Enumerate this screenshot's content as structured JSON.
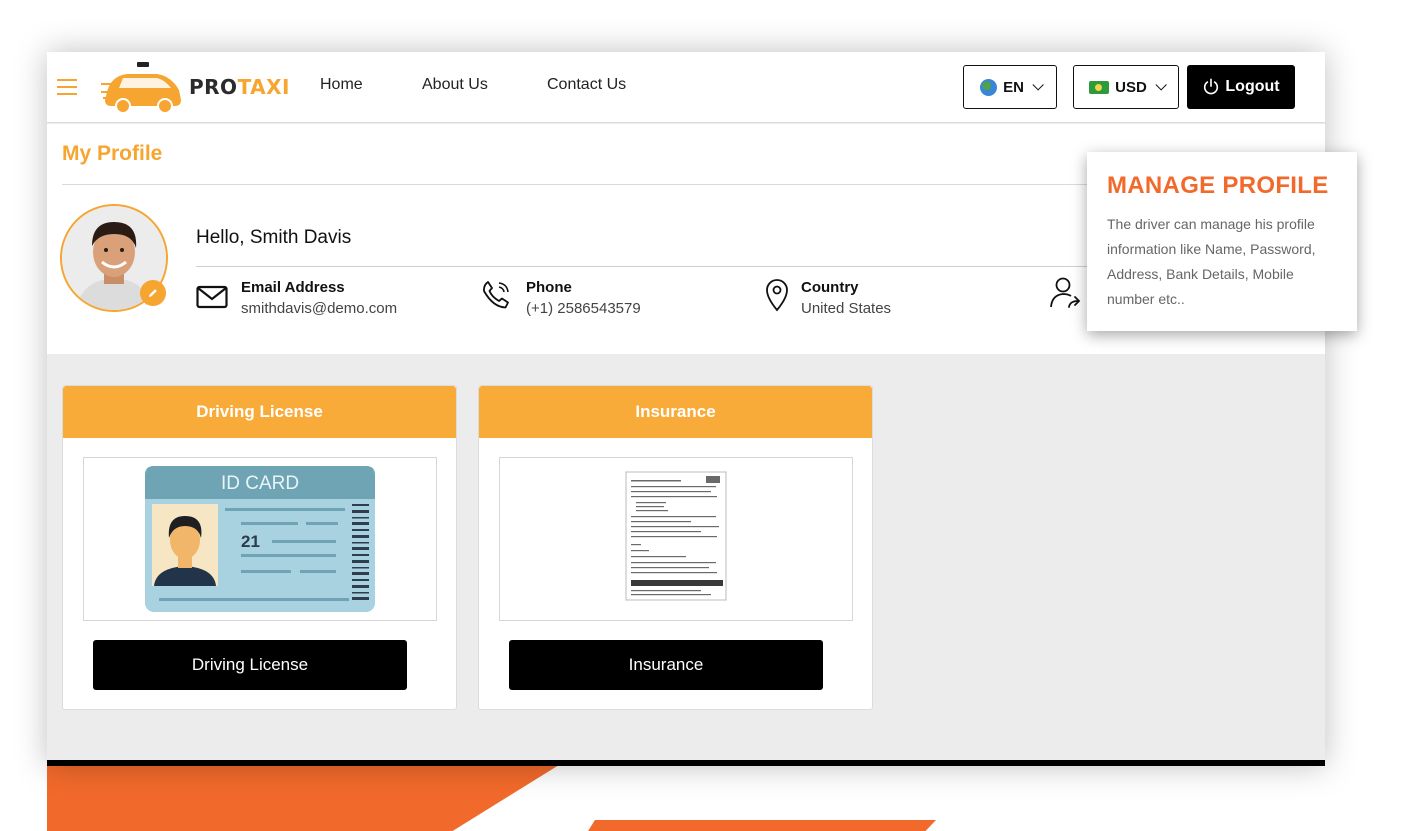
{
  "brand": {
    "name_part1": "PRO",
    "name_part2": "TAXI"
  },
  "nav": {
    "links": [
      "Home",
      "About Us",
      "Contact Us"
    ]
  },
  "header": {
    "language": "EN",
    "currency": "USD",
    "logout_label": "Logout"
  },
  "profile": {
    "page_title": "My Profile",
    "greeting": "Hello, Smith Davis",
    "email": {
      "label": "Email Address",
      "value": "smithdavis@demo.com"
    },
    "phone": {
      "label": "Phone",
      "value": "(+1) 2586543579"
    },
    "country": {
      "label": "Country",
      "value": "United States"
    }
  },
  "documents": [
    {
      "header": "Driving License",
      "button": "Driving License",
      "image_caption": "ID CARD",
      "card_number": "21"
    },
    {
      "header": "Insurance",
      "button": "Insurance"
    }
  ],
  "callout": {
    "title": "MANAGE PROFILE",
    "body": "The driver can manage his profile information like Name, Password, Address, Bank Details, Mobile number etc.."
  },
  "colors": {
    "accent": "#f7a531",
    "callout_title": "#f26a2b",
    "button_dark": "#000000"
  }
}
